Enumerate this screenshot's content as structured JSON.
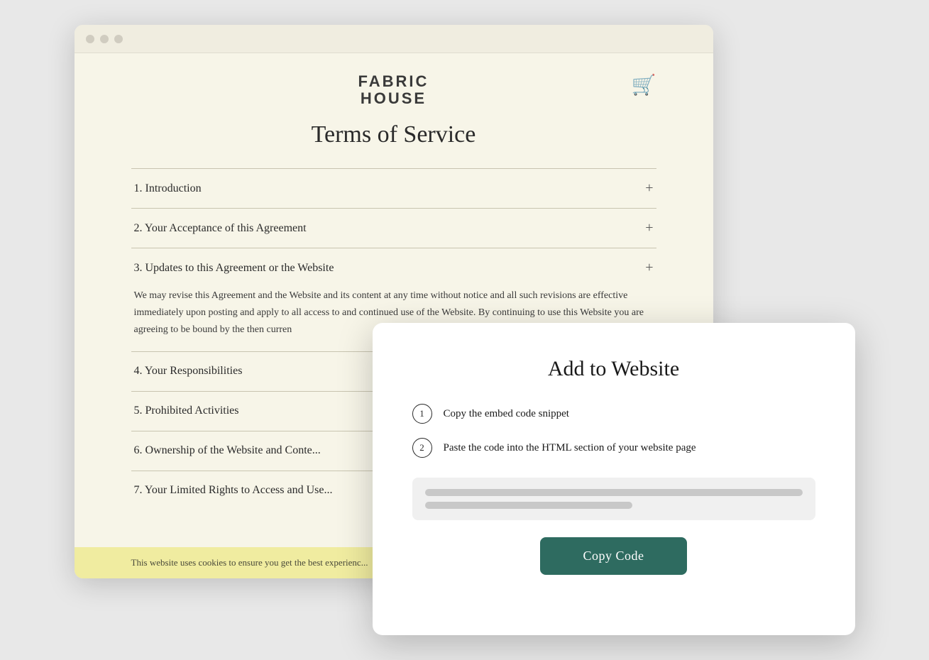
{
  "browser": {
    "traffic_lights": [
      "red",
      "yellow",
      "green"
    ]
  },
  "site": {
    "logo_line1": "FABRIC",
    "logo_line2": "HOUSE"
  },
  "page": {
    "title": "Terms of Service"
  },
  "accordion": {
    "items": [
      {
        "id": 1,
        "label": "1. Introduction",
        "expanded": false
      },
      {
        "id": 2,
        "label": "2. Your Acceptance of this Agreement",
        "expanded": false
      },
      {
        "id": 3,
        "label": "3. Updates to this Agreement or the Website",
        "expanded": true
      },
      {
        "id": 4,
        "label": "4. Your Responsibilities",
        "expanded": false
      },
      {
        "id": 5,
        "label": "5. Prohibited Activities",
        "expanded": false
      },
      {
        "id": 6,
        "label": "6. Ownership of the Website and Conte...",
        "expanded": false
      },
      {
        "id": 7,
        "label": "7. Your Limited Rights to Access and Use...",
        "expanded": false
      }
    ],
    "expanded_content": "We may revise this Agreement and the Website and its content at any time without notice and all such revisions are effective immediately upon posting and apply to all access to and continued use of the Website. By continuing to use this Website you are agreeing to be bound by the then curren"
  },
  "cookie_banner": {
    "text": "This website uses cookies to ensure you get the best experienc..."
  },
  "modal": {
    "title": "Add to Website",
    "step1": {
      "number": "1",
      "text": "Copy the embed code snippet"
    },
    "step2": {
      "number": "2",
      "text": "Paste the code into the HTML section of your website page"
    },
    "copy_button_label": "Copy Code"
  },
  "icons": {
    "cart": "🛒",
    "plus": "+",
    "minus": "−"
  },
  "colors": {
    "teal_button": "#2e6b60",
    "background": "#f7f5e8",
    "cookie_yellow": "#f0eca0"
  }
}
